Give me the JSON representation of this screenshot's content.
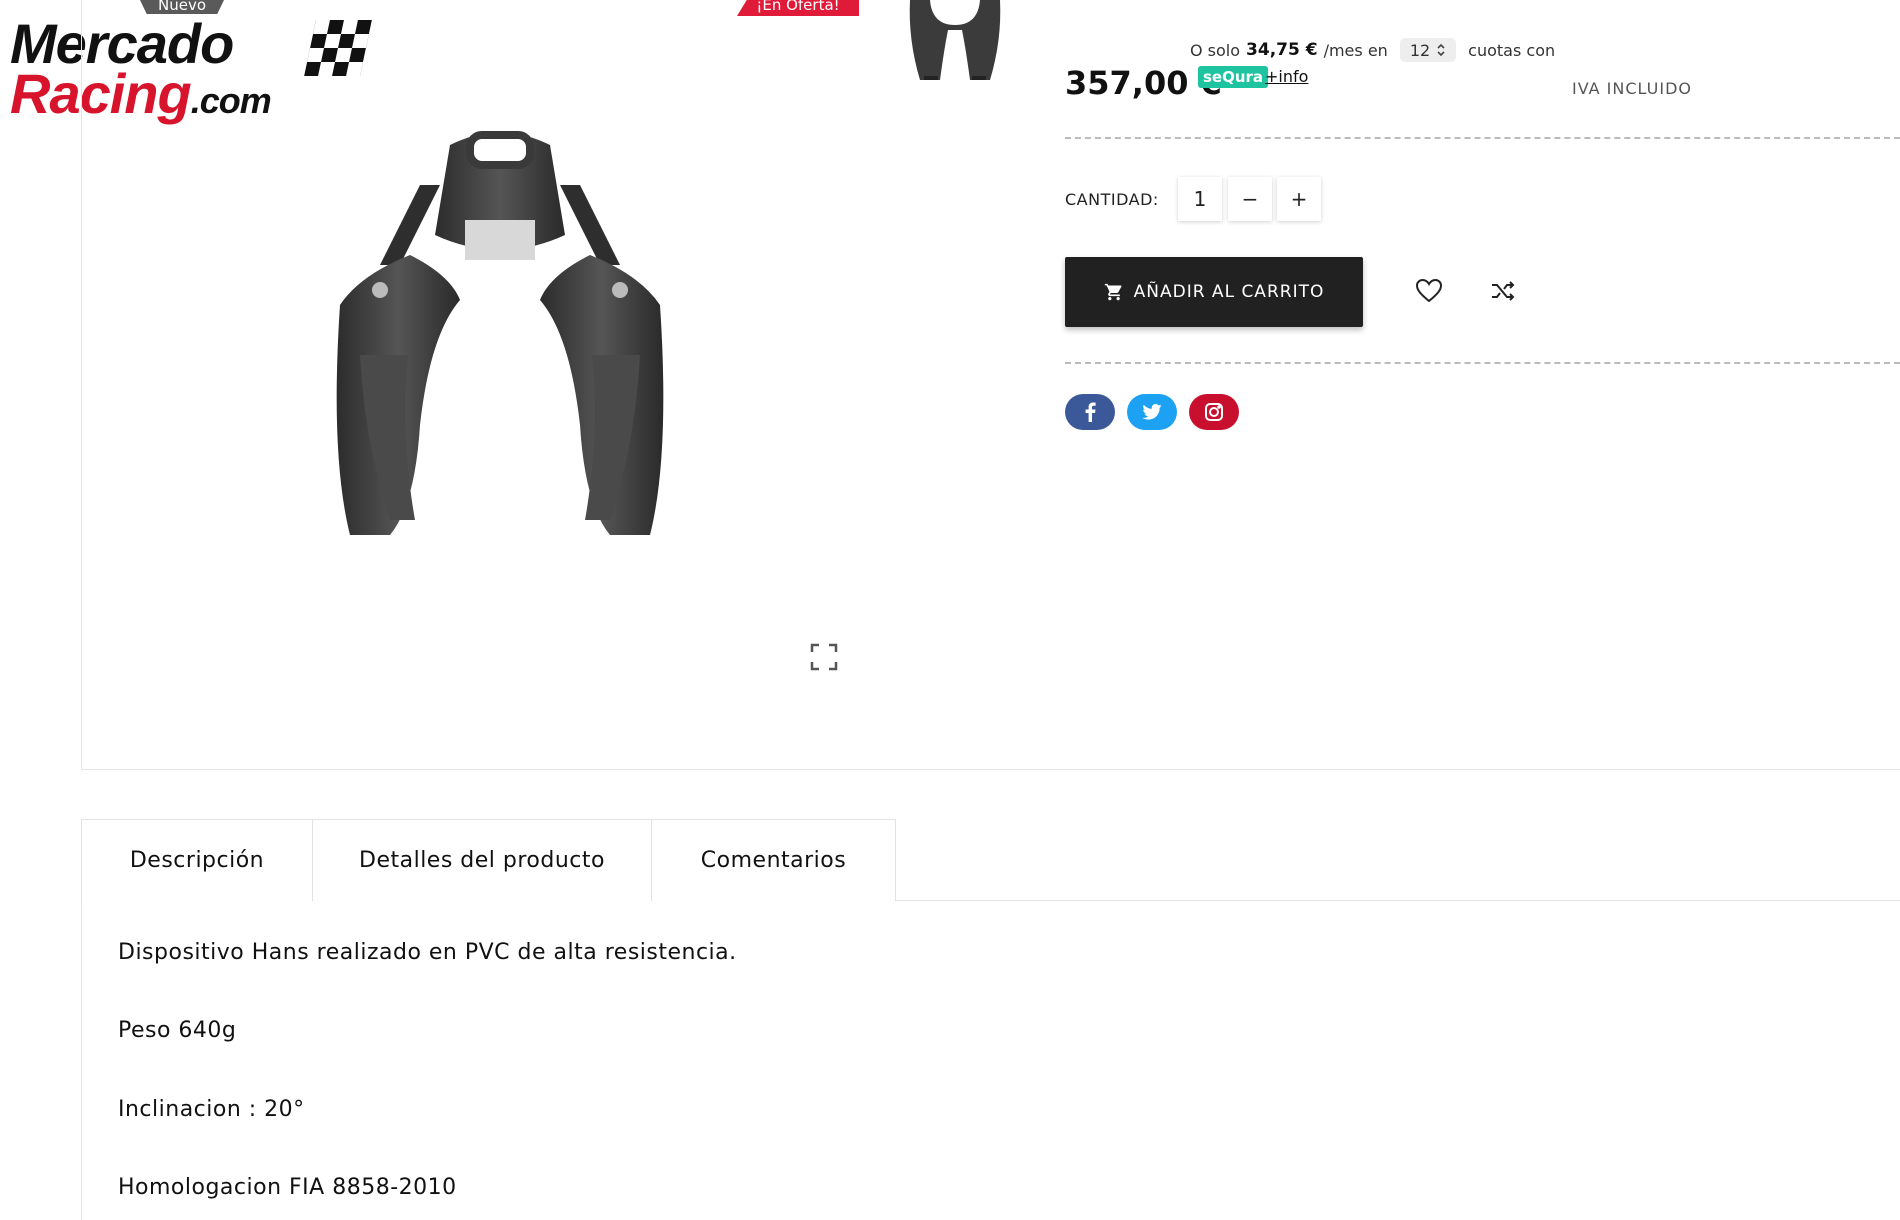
{
  "logo": {
    "top": "Mercado",
    "bottom": "Racing",
    "suffix": ".com"
  },
  "badges": {
    "new": "Nuevo",
    "offer": "¡En Oferta!"
  },
  "installment": {
    "prefix": "O solo",
    "amount": "34,75 €",
    "per": "/mes en",
    "months": "12",
    "suffix": "cuotas con"
  },
  "price": "357,00 €",
  "sequra": {
    "label": "seQura",
    "info": "+info"
  },
  "tax_note": "IVA INCLUIDO",
  "quantity": {
    "label": "CANTIDAD:",
    "value": "1",
    "minus": "−",
    "plus": "+"
  },
  "cart_button": "AÑADIR AL CARRITO",
  "icons": [
    "cart-icon",
    "heart-icon",
    "shuffle-icon",
    "facebook-icon",
    "twitter-icon",
    "instagram-icon",
    "fullscreen-icon"
  ],
  "social_colors": {
    "facebook": "#3b5998",
    "twitter": "#1da1f2",
    "instagram": "#c8102e"
  },
  "tabs": [
    {
      "label": "Descripción"
    },
    {
      "label": "Detalles del producto"
    },
    {
      "label": "Comentarios"
    }
  ],
  "description": [
    "Dispositivo Hans realizado en PVC de alta resistencia.",
    "Peso 640g",
    "Inclinacion : 20°",
    "Homologacion FIA 8858-2010"
  ]
}
